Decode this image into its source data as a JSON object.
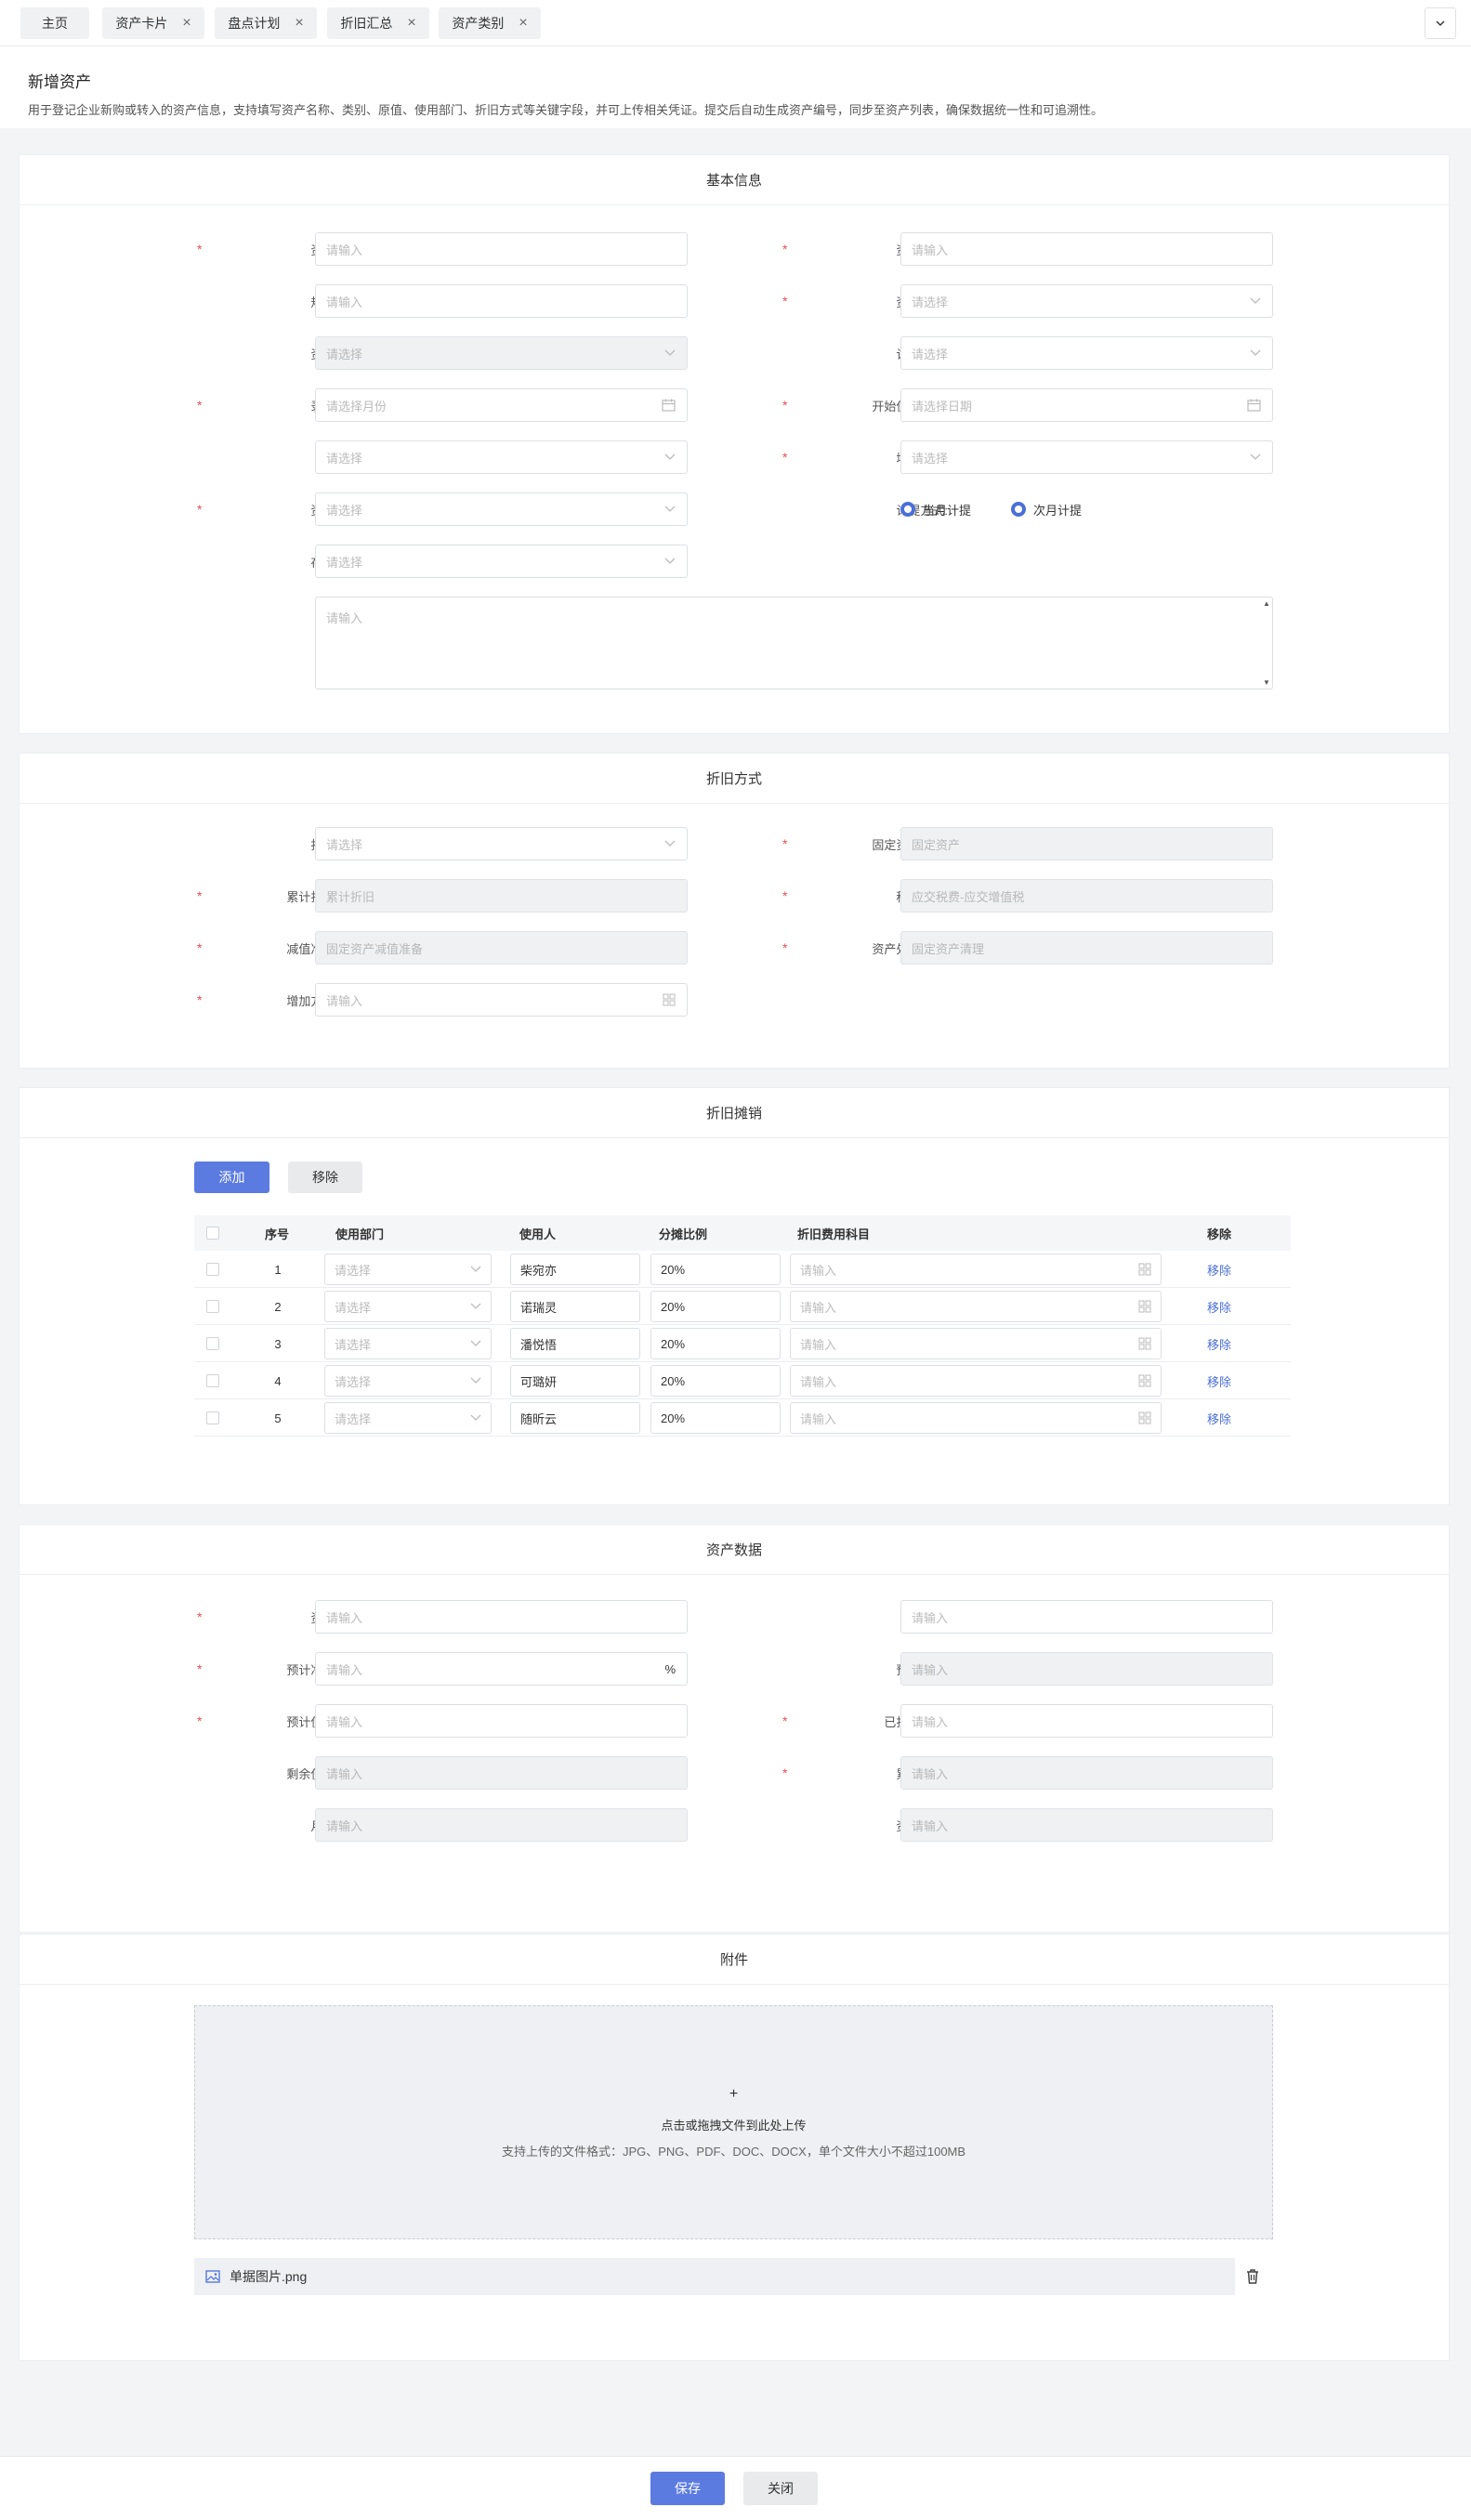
{
  "tabs": [
    {
      "label": "主页",
      "closable": false
    },
    {
      "label": "资产卡片",
      "closable": true
    },
    {
      "label": "盘点计划",
      "closable": true
    },
    {
      "label": "折旧汇总",
      "closable": true
    },
    {
      "label": "资产类别",
      "closable": true
    }
  ],
  "tab_close_glyph": "×",
  "tab_more_icon": "chevron-down-icon",
  "header": {
    "title": "新增资产",
    "description": "用于登记企业新购或转入的资产信息，支持填写资产名称、类别、原值、使用部门、折旧方式等关键字段，并可上传相关凭证。提交后自动生成资产编号，同步至资产列表，确保数据统一性和可追溯性。"
  },
  "basic": {
    "title": "基本信息",
    "left": [
      {
        "label": "资产编码:",
        "required": true,
        "placeholder": "请输入",
        "kind": "input"
      },
      {
        "label": "规格型号:",
        "required": false,
        "placeholder": "请输入",
        "kind": "input"
      },
      {
        "label": "资产属性:",
        "required": false,
        "placeholder": "请选择",
        "kind": "select-disabled"
      },
      {
        "label": "录入期间:",
        "required": true,
        "placeholder": "请选择月份",
        "kind": "date"
      },
      {
        "label": "供应商:",
        "required": false,
        "placeholder": "请选择",
        "kind": "select"
      },
      {
        "label": "资产状态:",
        "required": true,
        "placeholder": "请选择",
        "kind": "select"
      },
      {
        "label": "存放位置:",
        "required": false,
        "placeholder": "请选择",
        "kind": "select"
      }
    ],
    "right": [
      {
        "label": "资产名称:",
        "required": true,
        "placeholder": "请输入",
        "kind": "input"
      },
      {
        "label": "资产类别:",
        "required": true,
        "placeholder": "请选择",
        "kind": "select"
      },
      {
        "label": "计量单位:",
        "required": false,
        "placeholder": "请选择",
        "kind": "select"
      },
      {
        "label": "开始使用时间:",
        "required": true,
        "placeholder": "请选择日期",
        "kind": "date"
      },
      {
        "label": "增加方式:",
        "required": true,
        "placeholder": "请选择",
        "kind": "select"
      }
    ],
    "accrual": {
      "label": "计提方式:",
      "options": [
        "当月计提",
        "次月计提"
      ]
    },
    "remark": {
      "label": "备注:",
      "placeholder": "请输入"
    }
  },
  "depreciation": {
    "title": "折旧方式",
    "left": [
      {
        "label": "折旧方式:",
        "required": false,
        "value": "请选择",
        "kind": "select"
      },
      {
        "label": "累计折旧科目:",
        "required": true,
        "value": "累计折旧",
        "kind": "disabled"
      },
      {
        "label": "减值准备科目:",
        "required": true,
        "value": "固定资产减值准备",
        "kind": "disabled"
      },
      {
        "label": "增加方式科目:",
        "required": true,
        "value": "请输入",
        "kind": "grid"
      }
    ],
    "right": [
      {
        "label": "固定资产科目:",
        "required": true,
        "value": "固定资产",
        "kind": "disabled"
      },
      {
        "label": "税金科目:",
        "required": true,
        "value": "应交税费-应交增值税",
        "kind": "disabled"
      },
      {
        "label": "资产处置科目:",
        "required": true,
        "value": "固定资产清理",
        "kind": "disabled"
      }
    ]
  },
  "amortization": {
    "title": "折旧摊销",
    "add_label": "添加",
    "remove_label": "移除",
    "columns": [
      "序号",
      "使用部门",
      "使用人",
      "分摊比例",
      "折旧费用科目",
      "移除"
    ],
    "rows": [
      {
        "no": "1",
        "dept": "请选择",
        "user": "柴宛亦",
        "ratio": "20%",
        "subject": "请输入",
        "action": "移除"
      },
      {
        "no": "2",
        "dept": "请选择",
        "user": "诺瑞灵",
        "ratio": "20%",
        "subject": "请输入",
        "action": "移除"
      },
      {
        "no": "3",
        "dept": "请选择",
        "user": "潘悦悟",
        "ratio": "20%",
        "subject": "请输入",
        "action": "移除"
      },
      {
        "no": "4",
        "dept": "请选择",
        "user": "可璐妍",
        "ratio": "20%",
        "subject": "请输入",
        "action": "移除"
      },
      {
        "no": "5",
        "dept": "请选择",
        "user": "随昕云",
        "ratio": "20%",
        "subject": "请输入",
        "action": "移除"
      }
    ]
  },
  "asset_data": {
    "title": "资产数据",
    "left": [
      {
        "label": "资产原值:",
        "required": true,
        "value": "请输入",
        "disabled": false,
        "suffix": ""
      },
      {
        "label": "预计净残值率:",
        "required": true,
        "value": "请输入",
        "disabled": false,
        "suffix": "%"
      },
      {
        "label": "预计使用月份:",
        "required": true,
        "value": "请输入",
        "disabled": false,
        "suffix": ""
      },
      {
        "label": "剩余使用月份:",
        "required": false,
        "value": "请输入",
        "disabled": true,
        "suffix": ""
      },
      {
        "label": "月折旧额:",
        "required": false,
        "value": "请输入",
        "disabled": true,
        "suffix": ""
      }
    ],
    "right": [
      {
        "label": "税额:",
        "required": false,
        "value": "请输入",
        "disabled": false
      },
      {
        "label": "预计残值:",
        "required": false,
        "value": "请输入",
        "disabled": true
      },
      {
        "label": "已折旧月份:",
        "required": true,
        "value": "请输入",
        "disabled": false
      },
      {
        "label": "累计折旧:",
        "required": true,
        "value": "请输入",
        "disabled": true
      },
      {
        "label": "资产净值:",
        "required": false,
        "value": "请输入",
        "disabled": true
      }
    ]
  },
  "attachment": {
    "title": "附件",
    "plus": "+",
    "upload_text": "点击或拖拽文件到此处上传",
    "upload_hint": "支持上传的文件格式：JPG、PNG、PDF、DOC、DOCX，单个文件大小不超过100MB",
    "file_name": "单据图片.png"
  },
  "footer": {
    "save": "保存",
    "close": "关闭"
  },
  "colors": {
    "primary": "#5b7be0",
    "required": "#e34d59",
    "link": "#4b6fd8"
  }
}
